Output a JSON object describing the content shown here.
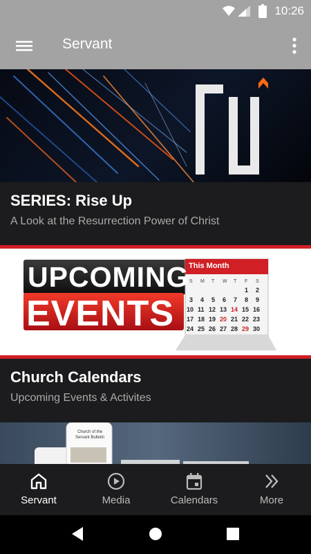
{
  "status": {
    "time": "10:26"
  },
  "appbar": {
    "title": "Servant"
  },
  "cards": [
    {
      "title": "SERIES: Rise Up",
      "subtitle": "A Look at the Resurrection Power of Christ",
      "banner_text": "RISEUP"
    },
    {
      "title": "Church Calendars",
      "subtitle": "Upcoming Events & Activites",
      "banner_word1": "UPCOMING",
      "banner_word2": "EVENTS",
      "calendar_header": "This Month"
    },
    {
      "phone_text": "Church of the Servant Bulletin"
    }
  ],
  "bottom_nav": [
    {
      "label": "Servant",
      "icon": "home-icon",
      "active": true
    },
    {
      "label": "Media",
      "icon": "play-circle-icon",
      "active": false
    },
    {
      "label": "Calendars",
      "icon": "calendar-icon",
      "active": false
    },
    {
      "label": "More",
      "icon": "chevron-double-right-icon",
      "active": false
    }
  ],
  "colors": {
    "appbar": "#a3a3a3",
    "background": "#1c1c1e",
    "accent_red": "#d01f25"
  }
}
